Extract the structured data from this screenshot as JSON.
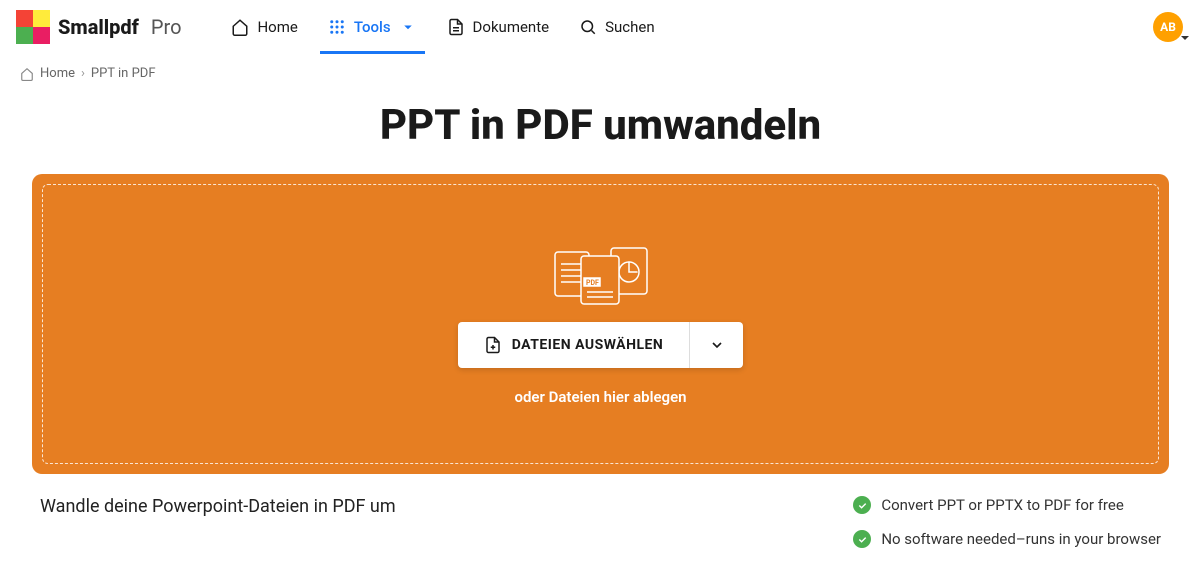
{
  "brand": {
    "name": "Smallpdf",
    "tier": "Pro"
  },
  "nav": {
    "home": "Home",
    "tools": "Tools",
    "documents": "Dokumente",
    "search": "Suchen"
  },
  "avatar": {
    "initials": "AB"
  },
  "breadcrumb": {
    "home": "Home",
    "current": "PPT in PDF"
  },
  "page": {
    "title": "PPT in PDF umwandeln",
    "choose_files": "DATEIEN AUSWÄHLEN",
    "drop_hint": "oder Dateien hier ablegen",
    "subheading": "Wandle deine Powerpoint-Dateien in PDF um"
  },
  "features": [
    "Convert PPT or PPTX to PDF for free",
    "No software needed–runs in your browser"
  ],
  "colors": {
    "accent_orange": "#e67e22",
    "brand_blue": "#1976f5",
    "success_green": "#4caf50",
    "avatar_bg": "#ffa000"
  }
}
